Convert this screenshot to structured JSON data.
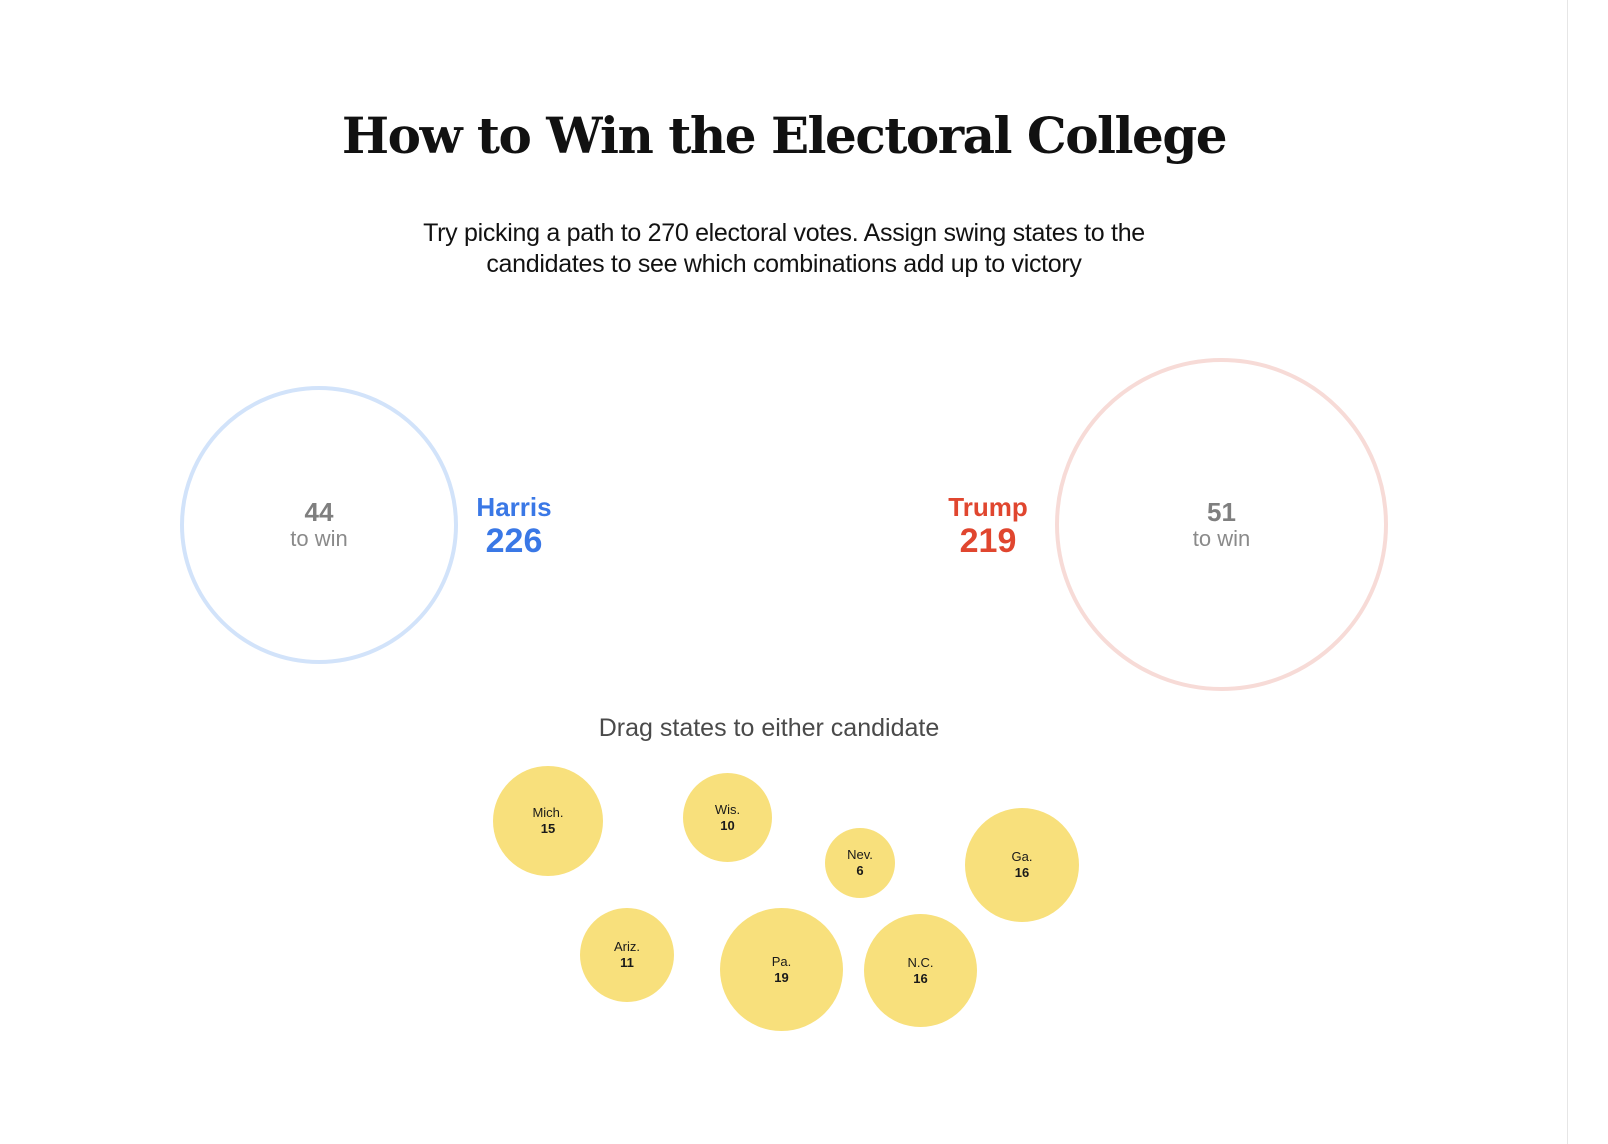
{
  "title": "How to Win the Electoral College",
  "subtitle": "Try picking a path to 270 electoral votes. Assign swing states to the candidates to see which combinations add up to victory",
  "candidates": {
    "harris": {
      "name": "Harris",
      "votes": "226",
      "to_win": "44",
      "to_win_label": "to win",
      "color": "#3a78e6",
      "ring_color": "#d2e3fa"
    },
    "trump": {
      "name": "Trump",
      "votes": "219",
      "to_win": "51",
      "to_win_label": "to win",
      "color": "#e0462f",
      "ring_color": "#f7dbd7"
    }
  },
  "drag_hint": "Drag states to either candidate",
  "state_color": "#f8e07c",
  "states": [
    {
      "abbr": "Mich.",
      "votes": "15"
    },
    {
      "abbr": "Wis.",
      "votes": "10"
    },
    {
      "abbr": "Nev.",
      "votes": "6"
    },
    {
      "abbr": "Ga.",
      "votes": "16"
    },
    {
      "abbr": "Ariz.",
      "votes": "11"
    },
    {
      "abbr": "Pa.",
      "votes": "19"
    },
    {
      "abbr": "N.C.",
      "votes": "16"
    }
  ]
}
